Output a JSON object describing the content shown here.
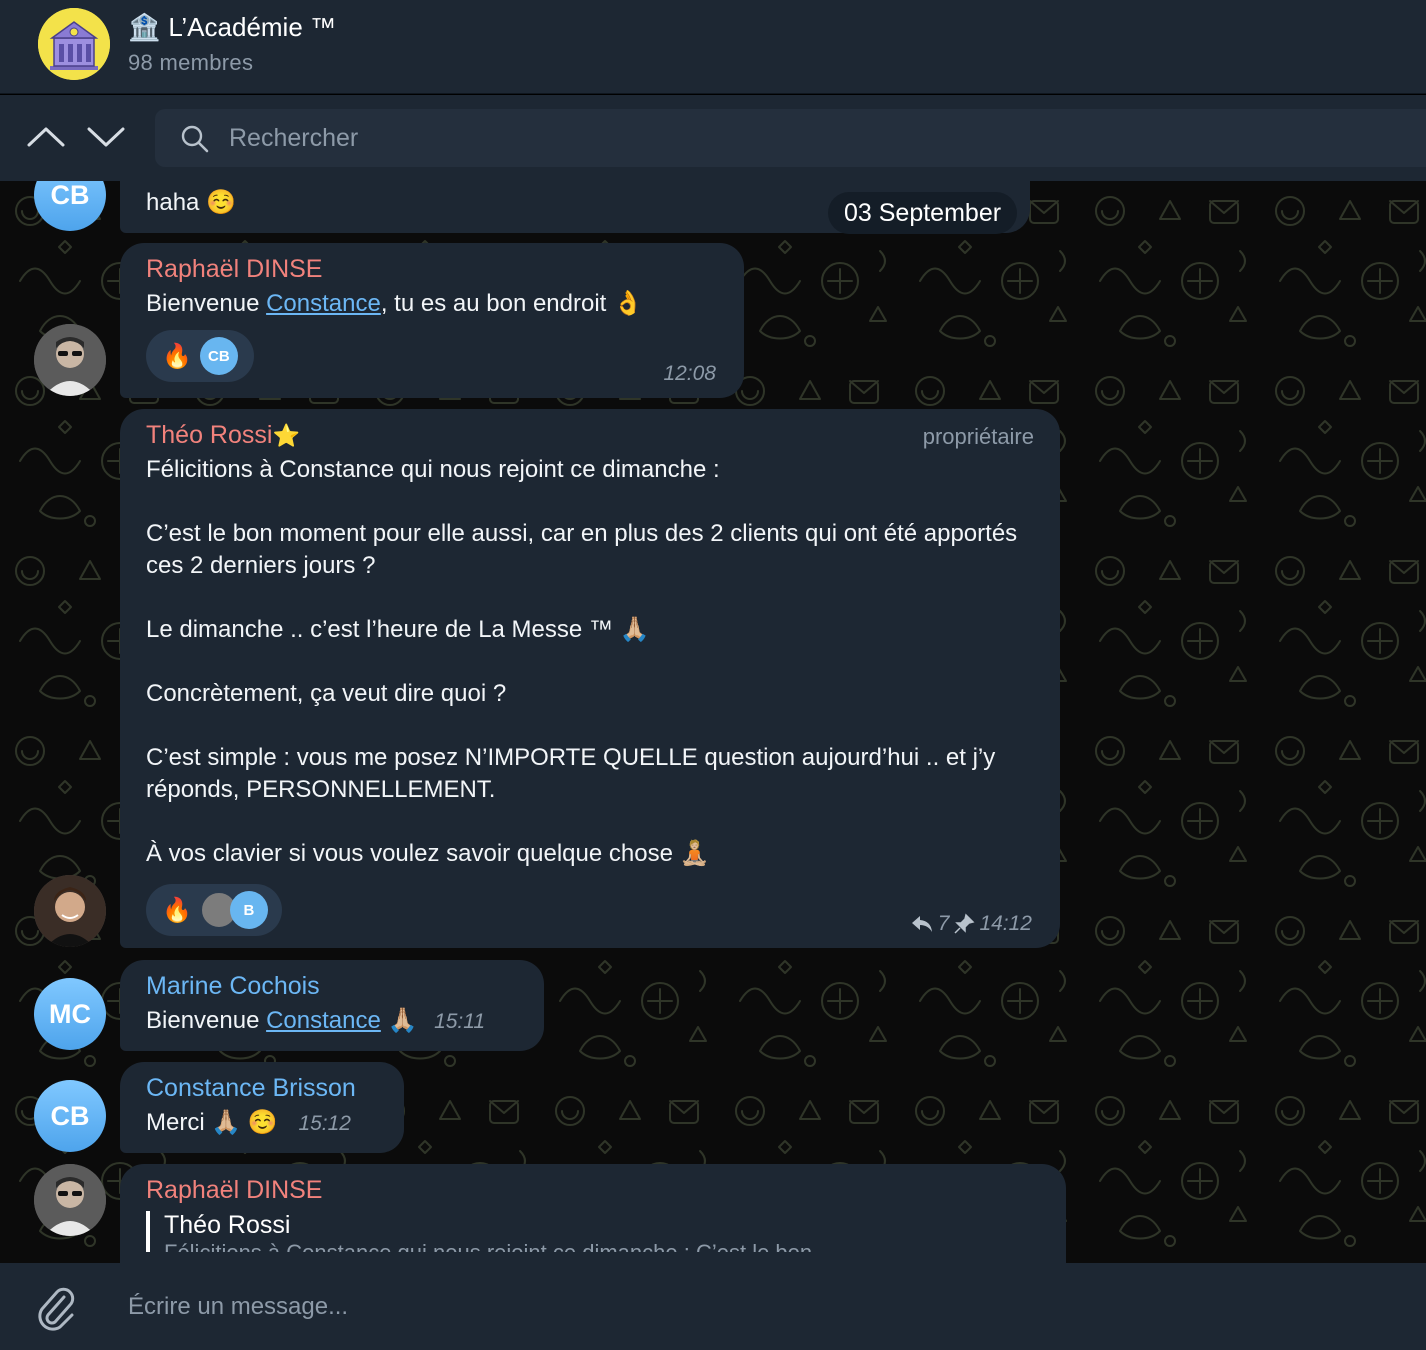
{
  "header": {
    "title_emoji": "🏦",
    "title": "L’Académie ™",
    "members": "98 membres",
    "avatar_color": "#f3e24a"
  },
  "search": {
    "placeholder": "Rechercher",
    "up_icon": "chevron-up-icon",
    "down_icon": "chevron-down-icon"
  },
  "chat": {
    "date_separator": "03 September",
    "top_partial": {
      "avatar_initials": "CB",
      "text": "haha ☺️"
    },
    "messages": [
      {
        "sender": "Raphaël DINSE",
        "text_before": "Bienvenue ",
        "mention": "Constance",
        "text_after": ", tu es au bon endroit 👌",
        "reaction": "🔥",
        "reactor_initials": "CB",
        "time": "12:08"
      },
      {
        "sender": "Théo Rossi",
        "sender_badge": "⭐",
        "role": "propriétaire",
        "paragraphs": [
          "Félicitions à Constance qui nous rejoint ce dimanche :",
          "C’est le bon moment pour elle aussi, car en plus des 2 clients qui ont été apportés ces 2 derniers jours ?",
          "Le dimanche .. c’est l’heure de La Messe ™ 🙏🏼",
          "Concrètement, ça veut dire quoi ?",
          "C’est simple : vous me posez N’IMPORTE QUELLE question aujourd’hui .. et j’y réponds, PERSONNELLEMENT.",
          "À vos clavier si vous voulez savoir quelque chose 🧘🏼"
        ],
        "reaction": "🔥",
        "reactor_initials": "B",
        "replies": "7",
        "time": "14:12"
      },
      {
        "sender": "Marine Cochois",
        "avatar_initials": "MC",
        "text_before": "Bienvenue ",
        "mention": "Constance",
        "text_after": " 🙏🏼",
        "time": "15:11"
      },
      {
        "sender": "Constance Brisson",
        "avatar_initials": "CB",
        "text": "Merci 🙏🏼 ☺️",
        "time": "15:12"
      },
      {
        "sender": "Raphaël DINSE",
        "reply_to": "Théo Rossi",
        "reply_preview": "Félicitions à Constance qui nous rejoint ce dimanche : C’est le bon"
      }
    ]
  },
  "composer": {
    "placeholder": "Écrire un message...",
    "attach_icon": "paperclip-icon"
  },
  "colors": {
    "panel": "#1d2733",
    "bubble": "#1d2733",
    "accent": "#6cb7f5",
    "sender_red": "#f1827c",
    "muted": "#8d9aa8"
  }
}
